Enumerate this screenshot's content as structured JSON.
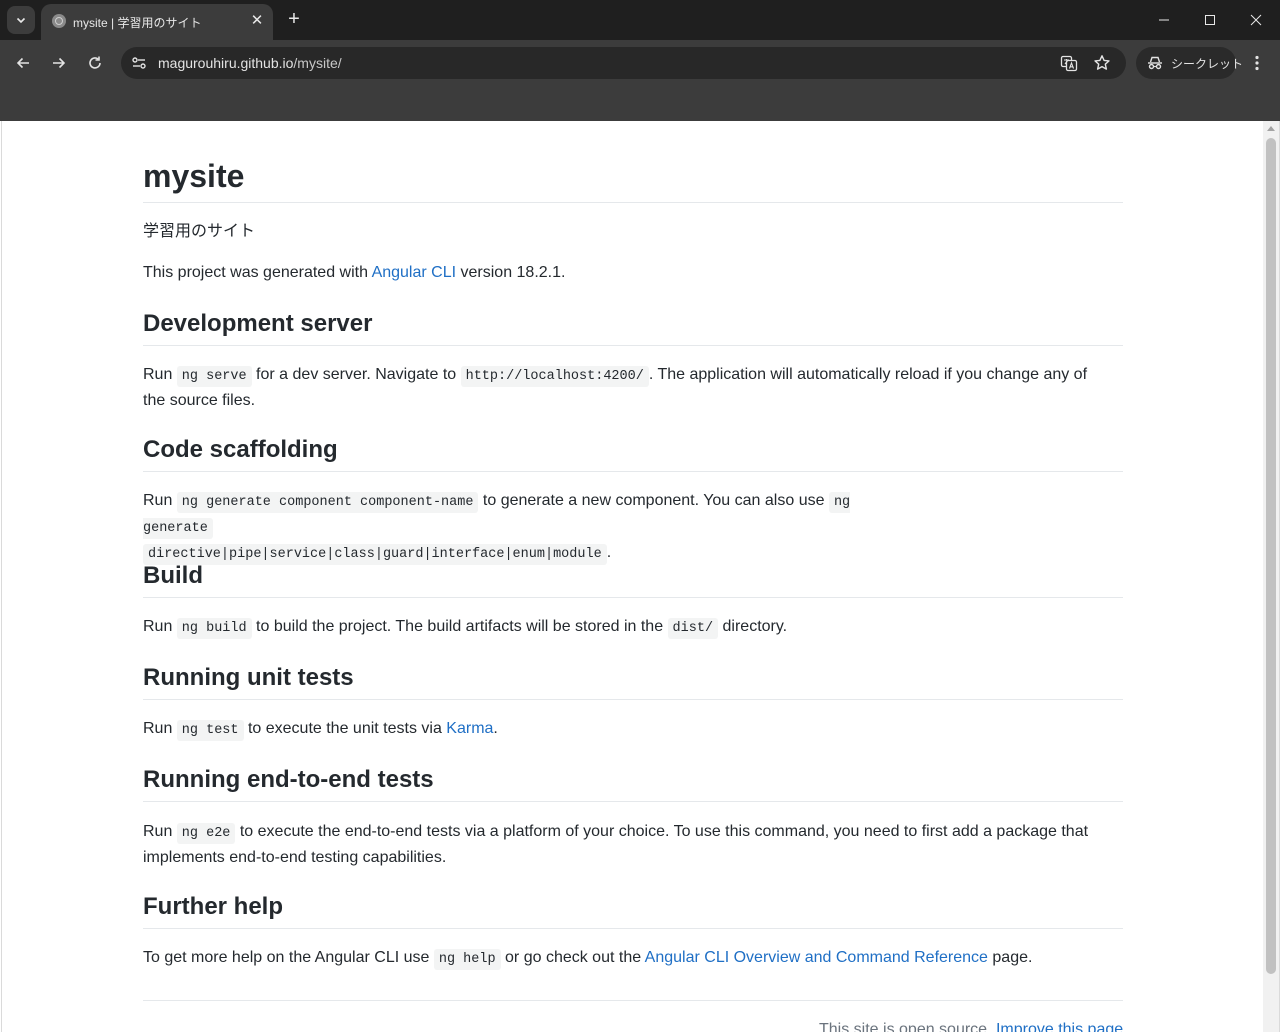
{
  "browser": {
    "tab_title": "mysite | 学習用のサイト",
    "url_host": "magurouhiru.github.io",
    "url_path": "/mysite/",
    "incognito_label": "シークレット"
  },
  "page": {
    "title": "mysite",
    "subtitle": "学習用のサイト",
    "intro": {
      "before": "This project was generated with ",
      "link": "Angular CLI",
      "after": " version 18.2.1."
    },
    "dev_server": {
      "heading": "Development server",
      "t1": "Run ",
      "code1": "ng serve",
      "t2": " for a dev server. Navigate to ",
      "code2": "http://localhost:4200/",
      "t3": ". The application will automatically reload if you change any of the source files."
    },
    "scaffolding": {
      "heading": "Code scaffolding",
      "t1": "Run ",
      "code1": "ng generate component component-name",
      "t2": " to generate a new component. You can also use ",
      "code2": "ng generate",
      "code3": "directive|pipe|service|class|guard|interface|enum|module",
      "t3": "."
    },
    "build": {
      "heading": "Build",
      "t1": "Run ",
      "code1": "ng build",
      "t2": " to build the project. The build artifacts will be stored in the ",
      "code2": "dist/",
      "t3": " directory."
    },
    "unit_tests": {
      "heading": "Running unit tests",
      "t1": "Run ",
      "code1": "ng test",
      "t2": " to execute the unit tests via ",
      "link": "Karma",
      "t3": "."
    },
    "e2e": {
      "heading": "Running end-to-end tests",
      "t1": "Run ",
      "code1": "ng e2e",
      "t2": " to execute the end-to-end tests via a platform of your choice. To use this command, you need to first add a package that implements end-to-end testing capabilities."
    },
    "help": {
      "heading": "Further help",
      "t1": "To get more help on the Angular CLI use ",
      "code1": "ng help",
      "t2": " or go check out the ",
      "link": "Angular CLI Overview and Command Reference",
      "t3": " page."
    },
    "footer": {
      "text": "This site is open source. ",
      "link": "Improve this page"
    }
  }
}
